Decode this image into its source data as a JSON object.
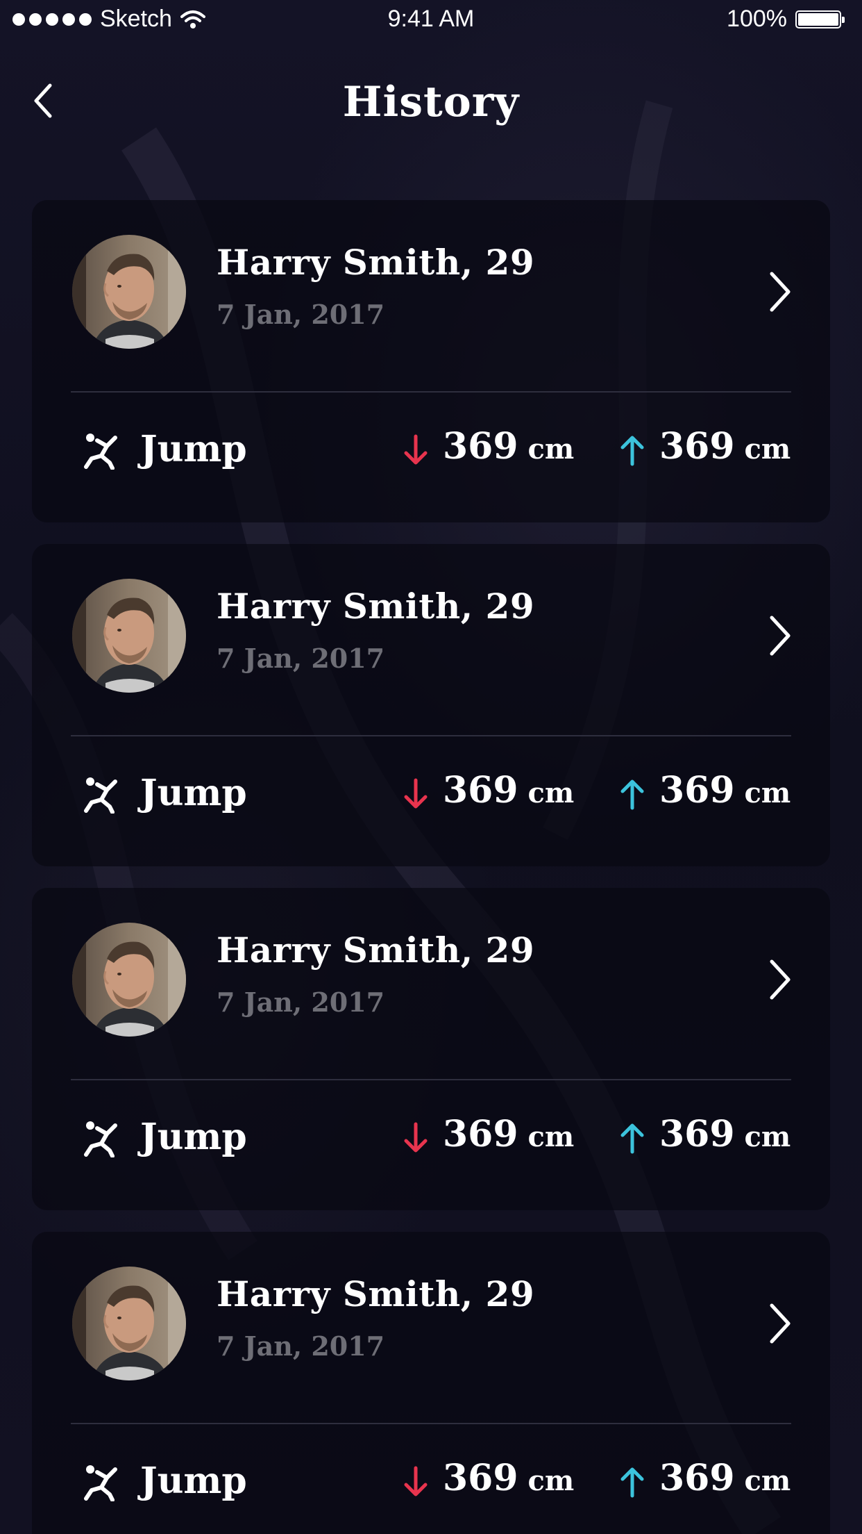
{
  "status_bar": {
    "carrier": "Sketch",
    "time": "9:41 AM",
    "battery": "100%"
  },
  "nav": {
    "title": "History"
  },
  "colors": {
    "down_arrow": "#e8344e",
    "up_arrow": "#3cc3dc",
    "date_text": "#6e6e76",
    "card_background": "#08080f"
  },
  "records": [
    {
      "name": "Harry Smith, 29",
      "date": "7 Jan, 2017",
      "activity": "Jump",
      "activity_icon": "jump-icon",
      "down_value": "369",
      "down_unit": "cm",
      "up_value": "369",
      "up_unit": "cm"
    },
    {
      "name": "Harry Smith, 29",
      "date": "7 Jan, 2017",
      "activity": "Jump",
      "activity_icon": "jump-icon",
      "down_value": "369",
      "down_unit": "cm",
      "up_value": "369",
      "up_unit": "cm"
    },
    {
      "name": "Harry Smith, 29",
      "date": "7 Jan, 2017",
      "activity": "Jump",
      "activity_icon": "jump-icon",
      "down_value": "369",
      "down_unit": "cm",
      "up_value": "369",
      "up_unit": "cm"
    },
    {
      "name": "Harry Smith, 29",
      "date": "7 Jan, 2017",
      "activity": "Jump",
      "activity_icon": "jump-icon",
      "down_value": "369",
      "down_unit": "cm",
      "up_value": "369",
      "up_unit": "cm"
    }
  ]
}
